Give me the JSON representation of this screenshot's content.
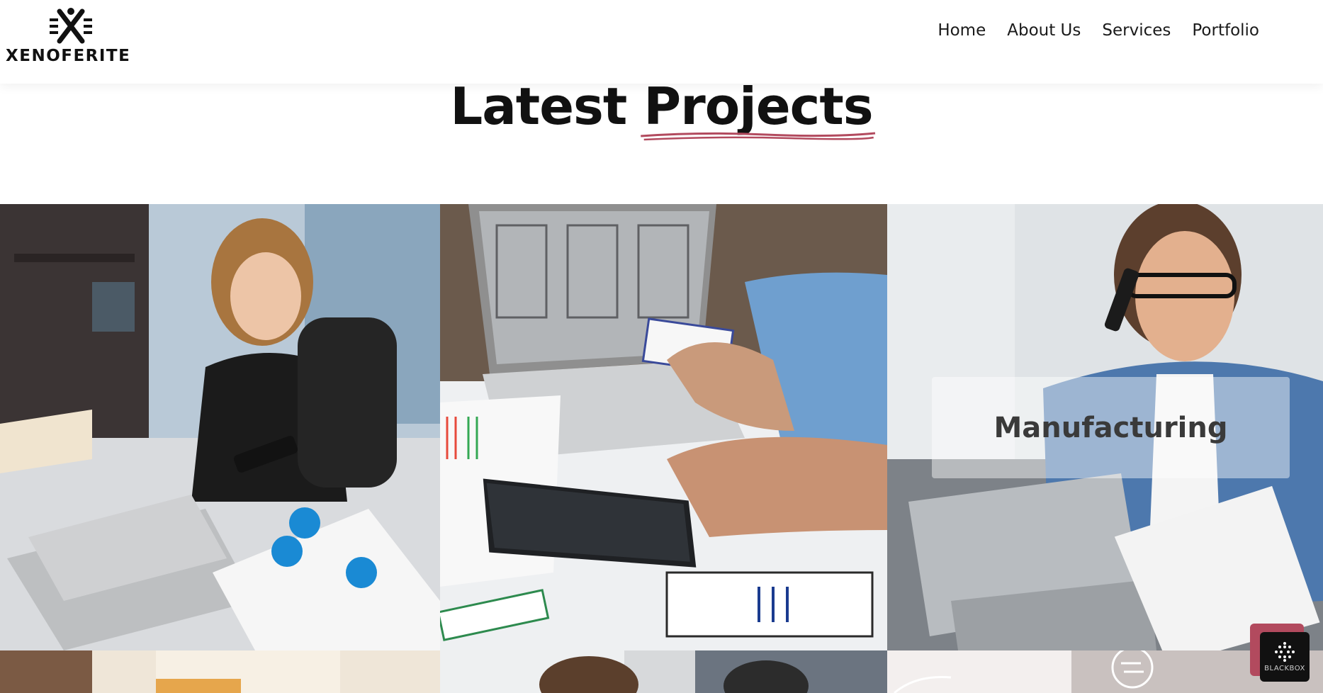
{
  "brand": {
    "name": "XENOFERITE",
    "logo_icon": "x-mark-logo-icon"
  },
  "nav": {
    "items": [
      {
        "label": "Home"
      },
      {
        "label": "About Us"
      },
      {
        "label": "Services"
      },
      {
        "label": "Portfolio"
      }
    ]
  },
  "section": {
    "title_word1": "Latest",
    "title_word2": "Projects",
    "accent_color": "#b24a5e"
  },
  "projects": [
    {
      "image": "woman-working-laptop-charts-photo",
      "label": ""
    },
    {
      "image": "wireframe-design-tablet-photo",
      "label": ""
    },
    {
      "image": "man-on-phone-with-laptop-photo",
      "label": "Manufacturing"
    },
    {
      "image": "project-photo-4",
      "label": ""
    },
    {
      "image": "project-photo-5",
      "label": ""
    },
    {
      "image": "project-photo-6",
      "label": ""
    }
  ],
  "widget": {
    "label": "BLACKBOX",
    "icon": "blackbox-dots-icon"
  }
}
